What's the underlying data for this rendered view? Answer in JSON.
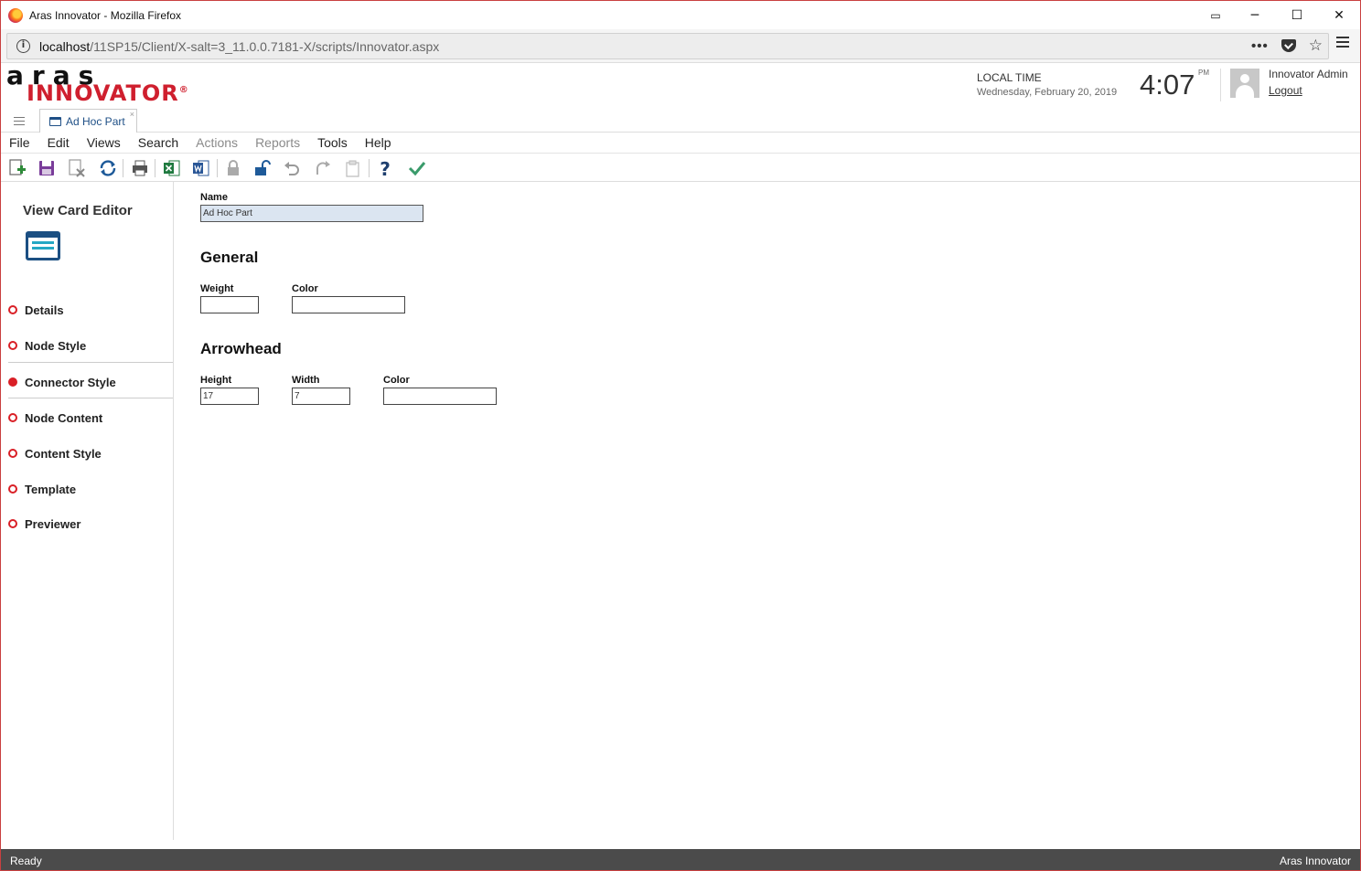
{
  "window": {
    "title": "Aras Innovator - Mozilla Firefox",
    "controls": [
      "▭",
      "─",
      "☐",
      "✕"
    ]
  },
  "browser": {
    "url_host": "localhost",
    "url_path": "/11SP15/Client/X-salt=3_11.0.0.7181-X/scripts/Innovator.aspx",
    "icons": [
      "info-icon",
      "more-icon",
      "pocket-icon",
      "bookmark-star-icon",
      "menu-icon"
    ]
  },
  "header": {
    "logo_top": "aras",
    "logo_bottom": "INNOVATOR",
    "logo_reg": "®",
    "local_time_label": "LOCAL TIME",
    "date": "Wednesday, February 20, 2019",
    "time": "4:07",
    "ampm": "PM",
    "user_name": "Innovator Admin",
    "logout": "Logout"
  },
  "tabs": [
    {
      "label": "Ad Hoc Part",
      "close": "×"
    }
  ],
  "menu": [
    {
      "label": "File",
      "enabled": true
    },
    {
      "label": "Edit",
      "enabled": true
    },
    {
      "label": "Views",
      "enabled": true
    },
    {
      "label": "Search",
      "enabled": true
    },
    {
      "label": "Actions",
      "enabled": false
    },
    {
      "label": "Reports",
      "enabled": false
    },
    {
      "label": "Tools",
      "enabled": true
    },
    {
      "label": "Help",
      "enabled": true
    }
  ],
  "toolbar": [
    "new-icon",
    "save-icon",
    "delete-icon",
    "refresh-icon",
    "print-icon",
    "excel-icon",
    "word-icon",
    "lock-icon",
    "unlock-icon",
    "undo-icon",
    "redo-icon",
    "copy-icon",
    "help-icon",
    "done-icon"
  ],
  "sidebar": {
    "title": "View Card Editor",
    "icon": "view-card-icon",
    "items": [
      {
        "label": "Details",
        "active": false
      },
      {
        "label": "Node Style",
        "active": false
      },
      {
        "label": "Connector Style",
        "active": true
      },
      {
        "label": "Node Content",
        "active": false
      },
      {
        "label": "Content Style",
        "active": false
      },
      {
        "label": "Template",
        "active": false
      },
      {
        "label": "Previewer",
        "active": false
      }
    ]
  },
  "form": {
    "name_label": "Name",
    "name_value": "Ad Hoc Part",
    "general_heading": "General",
    "weight_label": "Weight",
    "weight_value": "",
    "color_label": "Color",
    "color_value": "",
    "arrowhead_heading": "Arrowhead",
    "height_label": "Height",
    "height_value": "17",
    "width_label": "Width",
    "width_value": "7",
    "arrow_color_label": "Color",
    "arrow_color_value": ""
  },
  "status": {
    "left": "Ready",
    "right": "Aras Innovator"
  },
  "colors": {
    "brand_red": "#cf1f2e",
    "active_dot": "#d91f26",
    "tab_blue": "#1e4f86",
    "status_bar": "#4b4b4b",
    "name_field_bg": "#dbe5f1"
  }
}
